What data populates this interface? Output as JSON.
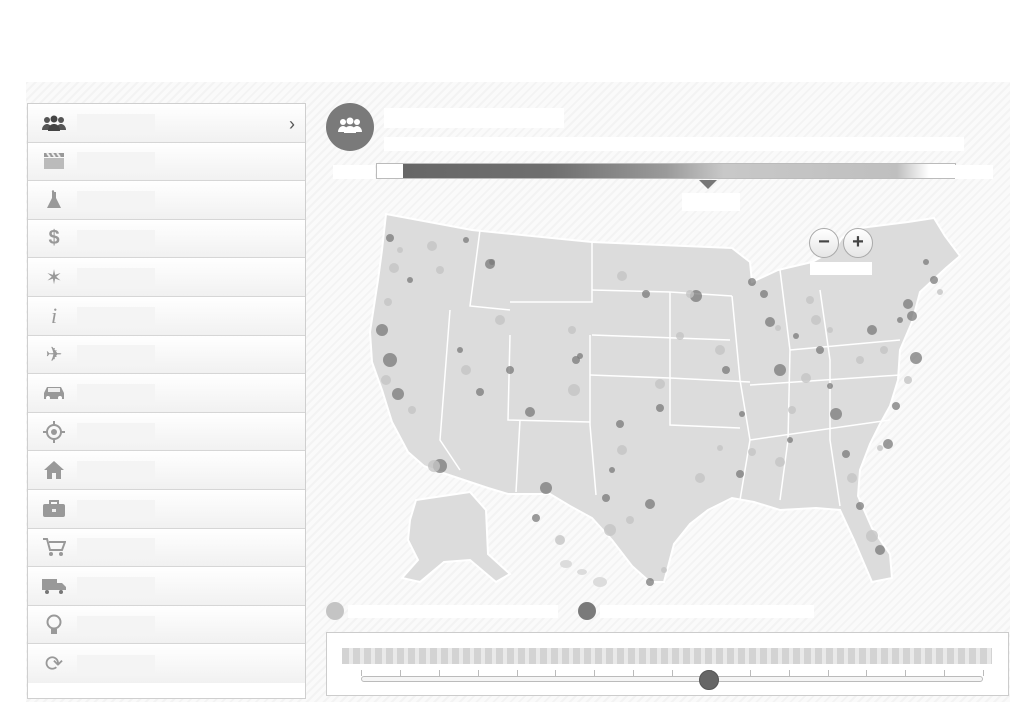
{
  "header": {
    "title": "",
    "subtitle": ""
  },
  "sidebar": {
    "items": [
      {
        "label": "",
        "icon": "people-icon",
        "active": true
      },
      {
        "label": "",
        "icon": "clapperboard-icon"
      },
      {
        "label": "",
        "icon": "flask-icon"
      },
      {
        "label": "",
        "icon": "dollar-icon"
      },
      {
        "label": "",
        "icon": "badge-star-icon"
      },
      {
        "label": "",
        "icon": "info-icon"
      },
      {
        "label": "",
        "icon": "airplane-icon"
      },
      {
        "label": "",
        "icon": "car-icon"
      },
      {
        "label": "",
        "icon": "target-icon"
      },
      {
        "label": "",
        "icon": "house-icon"
      },
      {
        "label": "",
        "icon": "briefcase-icon"
      },
      {
        "label": "",
        "icon": "shopping-cart-icon"
      },
      {
        "label": "",
        "icon": "truck-icon"
      },
      {
        "label": "",
        "icon": "lightbulb-icon"
      },
      {
        "label": "",
        "icon": "refresh-icon"
      }
    ]
  },
  "panel": {
    "icon": "people-icon",
    "title": "",
    "description": "",
    "scale": {
      "min_label": "",
      "max_label": "",
      "current_value": ""
    },
    "zoom": {
      "out_label": "−",
      "in_label": "+",
      "caption": ""
    },
    "legend": [
      {
        "label": "",
        "color": "#c4c4c4"
      },
      {
        "label": "",
        "color": "#7a7a7a"
      }
    ]
  },
  "timeline": {
    "start_label": "",
    "current_label": "",
    "selected_fraction": 0.56
  },
  "colors": {
    "accent": "#7a7a7a",
    "map_fill": "#dcdcdc",
    "map_border": "#ffffff",
    "dot_light": "#c4c4c4",
    "dot_dark": "#7a7a7a"
  }
}
